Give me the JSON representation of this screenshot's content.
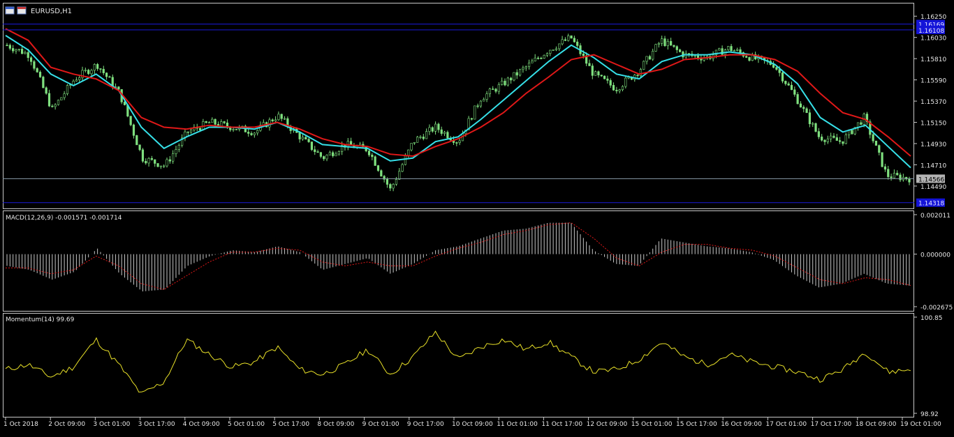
{
  "window": {
    "title": "EURUSD,H1",
    "icon": "chart-window-icon"
  },
  "colors": {
    "background": "#000000",
    "frame": "#c8c8c8",
    "candle": "#7fe07f",
    "fast_ma": "#36e0e8",
    "slow_ma": "#e01818",
    "macd_hist": "#c8c8c8",
    "macd_signal": "#e01818",
    "momentum": "#e8e028",
    "level_line": "#1a1ad8",
    "level_label": "#1414d8",
    "bid_line": "#8a9aa8",
    "bid_label": "#b4b4b4"
  },
  "price_panel": {
    "y_ticks": [
      "1.16250",
      "1.16030",
      "1.15810",
      "1.15590",
      "1.15370",
      "1.15150",
      "1.14930",
      "1.14710",
      "1.14490"
    ],
    "levels": [
      {
        "label": "1.16169",
        "value": 1.16169
      },
      {
        "label": "1.16108",
        "value": 1.16108
      },
      {
        "label": "1.14318",
        "value": 1.14318
      }
    ],
    "bid": {
      "label": "1.14566",
      "value": 1.14566
    }
  },
  "macd_panel": {
    "title": "MACD(12,26,9) -0.001571 -0.001714",
    "y_ticks": [
      "0.002011",
      "0.000000",
      "-0.002675"
    ]
  },
  "momentum_panel": {
    "title": "Momentum(14) 99.69",
    "y_ticks": [
      "100.85",
      "98.92"
    ]
  },
  "time_axis": {
    "labels": [
      "1 Oct 2018",
      "2 Oct 09:00",
      "3 Oct 01:00",
      "3 Oct 17:00",
      "4 Oct 09:00",
      "5 Oct 01:00",
      "5 Oct 17:00",
      "8 Oct 09:00",
      "9 Oct 01:00",
      "9 Oct 17:00",
      "10 Oct 09:00",
      "11 Oct 01:00",
      "11 Oct 17:00",
      "12 Oct 09:00",
      "15 Oct 01:00",
      "15 Oct 17:00",
      "16 Oct 09:00",
      "17 Oct 01:00",
      "17 Oct 17:00",
      "18 Oct 09:00",
      "19 Oct 01:00"
    ]
  },
  "chart_data": {
    "type": "line",
    "symbol": "EURUSD",
    "timeframe": "H1",
    "price": {
      "ylim": [
        1.1428,
        1.1636
      ],
      "x": [
        "1 Oct 2018",
        "1 Oct 12:00",
        "2 Oct 09:00",
        "2 Oct 21:00",
        "3 Oct 01:00",
        "3 Oct 09:00",
        "3 Oct 17:00",
        "4 Oct 03:00",
        "4 Oct 09:00",
        "4 Oct 21:00",
        "5 Oct 01:00",
        "5 Oct 09:00",
        "5 Oct 17:00",
        "8 Oct 03:00",
        "8 Oct 09:00",
        "8 Oct 21:00",
        "9 Oct 01:00",
        "9 Oct 09:00",
        "9 Oct 17:00",
        "10 Oct 03:00",
        "10 Oct 09:00",
        "10 Oct 21:00",
        "11 Oct 01:00",
        "11 Oct 09:00",
        "11 Oct 17:00",
        "12 Oct 01:00",
        "12 Oct 09:00",
        "12 Oct 21:00",
        "15 Oct 01:00",
        "15 Oct 09:00",
        "15 Oct 17:00",
        "16 Oct 01:00",
        "16 Oct 09:00",
        "16 Oct 21:00",
        "17 Oct 01:00",
        "17 Oct 09:00",
        "17 Oct 17:00",
        "18 Oct 03:00",
        "18 Oct 09:00",
        "18 Oct 21:00",
        "19 Oct 01:00"
      ],
      "close": [
        1.1595,
        1.1585,
        1.1528,
        1.156,
        1.1575,
        1.1545,
        1.1478,
        1.147,
        1.1505,
        1.1515,
        1.151,
        1.1505,
        1.1522,
        1.15,
        1.1478,
        1.1492,
        1.1487,
        1.1445,
        1.1495,
        1.151,
        1.1495,
        1.154,
        1.1555,
        1.1572,
        1.159,
        1.1603,
        1.1565,
        1.155,
        1.1568,
        1.16,
        1.1585,
        1.1582,
        1.1592,
        1.1582,
        1.1575,
        1.154,
        1.15,
        1.1495,
        1.152,
        1.146,
        1.1457
      ],
      "series": [
        {
          "name": "fast MA",
          "values": [
            1.1605,
            1.159,
            1.1565,
            1.1553,
            1.1565,
            1.1548,
            1.151,
            1.1488,
            1.15,
            1.151,
            1.151,
            1.1508,
            1.1515,
            1.1505,
            1.1492,
            1.149,
            1.1488,
            1.1475,
            1.1478,
            1.1495,
            1.15,
            1.1518,
            1.1538,
            1.1558,
            1.1578,
            1.1595,
            1.1582,
            1.1565,
            1.156,
            1.1578,
            1.1585,
            1.1585,
            1.1588,
            1.1585,
            1.1575,
            1.1555,
            1.152,
            1.1505,
            1.1512,
            1.149,
            1.1468
          ]
        },
        {
          "name": "slow MA",
          "values": [
            1.1612,
            1.16,
            1.1572,
            1.1565,
            1.156,
            1.1548,
            1.152,
            1.151,
            1.1508,
            1.1512,
            1.151,
            1.151,
            1.1515,
            1.1508,
            1.1498,
            1.1492,
            1.149,
            1.1482,
            1.148,
            1.149,
            1.1498,
            1.151,
            1.1525,
            1.1545,
            1.1562,
            1.158,
            1.1585,
            1.1575,
            1.1565,
            1.157,
            1.158,
            1.1582,
            1.1585,
            1.1585,
            1.158,
            1.1568,
            1.1545,
            1.1525,
            1.1518,
            1.15,
            1.148
          ]
        }
      ]
    },
    "macd": {
      "ylim": [
        -0.002675,
        0.002011
      ],
      "histogram": [
        -0.0006,
        -0.0008,
        -0.0013,
        -0.0009,
        0.0003,
        -0.001,
        -0.0019,
        -0.0018,
        -0.0006,
        -0.0001,
        0.0002,
        0.0001,
        0.0004,
        0.0001,
        -0.0008,
        -0.0005,
        -0.0002,
        -0.001,
        -0.0005,
        0.0002,
        0.0004,
        0.0008,
        0.0012,
        0.0013,
        0.0016,
        0.0016,
        0.0002,
        -0.0005,
        -0.0006,
        0.0008,
        0.0006,
        0.0004,
        0.0003,
        0.0001,
        -0.0003,
        -0.0011,
        -0.0017,
        -0.0015,
        -0.001,
        -0.0015,
        -0.0016
      ],
      "signal": [
        -0.0007,
        -0.0007,
        -0.001,
        -0.0008,
        -0.0001,
        -0.0006,
        -0.0015,
        -0.0018,
        -0.0011,
        -0.0004,
        0.0001,
        0.0001,
        0.0003,
        0.0002,
        -0.0004,
        -0.0006,
        -0.0004,
        -0.0006,
        -0.0006,
        -0.0001,
        0.0003,
        0.0006,
        0.001,
        0.0012,
        0.0015,
        0.0016,
        0.0008,
        -0.0002,
        -0.0006,
        0.0001,
        0.0005,
        0.0005,
        0.0003,
        0.0002,
        -0.0001,
        -0.0007,
        -0.0013,
        -0.0015,
        -0.0012,
        -0.0013,
        -0.0016
      ]
    },
    "momentum": {
      "ylim": [
        98.92,
        100.85
      ],
      "values": [
        99.8,
        99.9,
        99.65,
        99.85,
        100.4,
        99.9,
        99.3,
        99.55,
        100.4,
        100.1,
        99.85,
        99.95,
        100.25,
        99.8,
        99.7,
        99.9,
        100.2,
        99.7,
        100.05,
        100.55,
        100.0,
        100.25,
        100.4,
        100.2,
        100.35,
        100.05,
        99.75,
        99.8,
        100.0,
        100.35,
        100.05,
        99.9,
        100.1,
        99.95,
        99.85,
        99.75,
        99.6,
        99.8,
        100.15,
        99.75,
        99.8
      ]
    }
  }
}
